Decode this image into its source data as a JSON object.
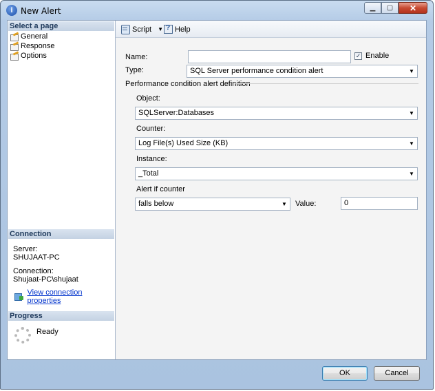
{
  "window": {
    "title": "New Alert",
    "icon": "info-icon",
    "controls": [
      "minimize",
      "maximize",
      "close"
    ]
  },
  "left_pane": {
    "select_page_header": "Select a page",
    "pages": [
      {
        "label": "General",
        "icon": "page-icon"
      },
      {
        "label": "Response",
        "icon": "page-icon"
      },
      {
        "label": "Options",
        "icon": "page-icon"
      }
    ],
    "connection_header": "Connection",
    "server_label": "Server:",
    "server_value": "SHUJAAT-PC",
    "connection_label": "Connection:",
    "connection_value": "Shujaat-PC\\shujaat",
    "view_connection_link": "View connection properties",
    "progress_header": "Progress",
    "progress_status": "Ready"
  },
  "toolbar": {
    "script_label": "Script",
    "help_label": "Help"
  },
  "form": {
    "name_label": "Name:",
    "name_value": "",
    "enable_label": "Enable",
    "enable_checked": true,
    "type_label": "Type:",
    "type_value": "SQL Server performance condition alert",
    "group_title": "Performance condition alert definition",
    "object_label": "Object:",
    "object_value": "SQLServer:Databases",
    "counter_label": "Counter:",
    "counter_value": "Log File(s) Used Size (KB)",
    "instance_label": "Instance:",
    "instance_value": "_Total",
    "alert_if_label": "Alert if counter",
    "alert_if_value": "falls below",
    "value_label": "Value:",
    "value_value": "0"
  },
  "buttons": {
    "ok": "OK",
    "cancel": "Cancel"
  }
}
